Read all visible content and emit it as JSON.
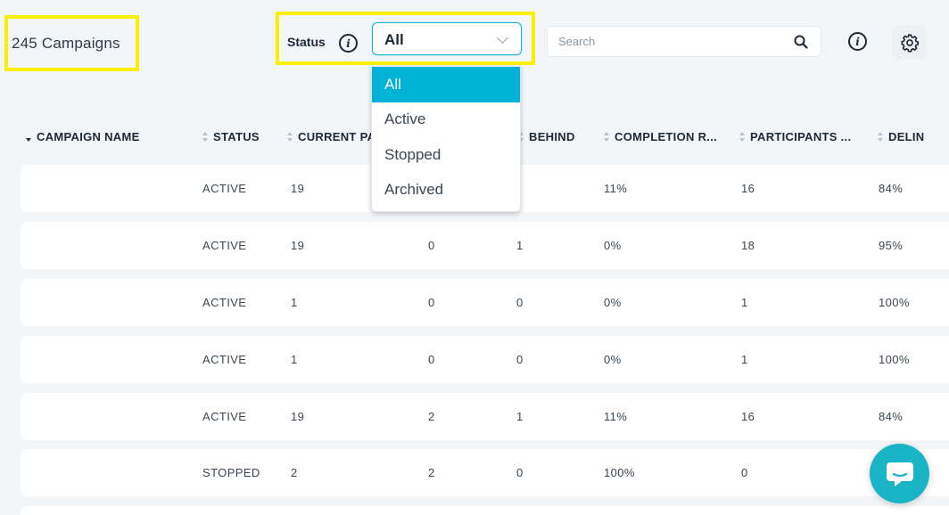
{
  "header": {
    "campaign_count": "245 Campaigns",
    "status_label": "Status",
    "status_selected": "All",
    "search_placeholder": "Search"
  },
  "status_options": [
    "All",
    "Active",
    "Stopped",
    "Archived"
  ],
  "columns": [
    "CAMPAIGN NAME",
    "STATUS",
    "CURRENT PA",
    "BEHIND",
    "COMPLETION R...",
    "PARTICIPANTS ...",
    "DELIN"
  ],
  "rows": [
    {
      "status": "ACTIVE",
      "current": "19",
      "col4": "",
      "behind": "",
      "completion": "11%",
      "participants": "16",
      "delin": "84%"
    },
    {
      "status": "ACTIVE",
      "current": "19",
      "col4": "0",
      "behind": "1",
      "completion": "0%",
      "participants": "18",
      "delin": "95%"
    },
    {
      "status": "ACTIVE",
      "current": "1",
      "col4": "0",
      "behind": "0",
      "completion": "0%",
      "participants": "1",
      "delin": "100%"
    },
    {
      "status": "ACTIVE",
      "current": "1",
      "col4": "0",
      "behind": "0",
      "completion": "0%",
      "participants": "1",
      "delin": "100%"
    },
    {
      "status": "ACTIVE",
      "current": "19",
      "col4": "2",
      "behind": "1",
      "completion": "11%",
      "participants": "16",
      "delin": "84%"
    },
    {
      "status": "STOPPED",
      "current": "2",
      "col4": "2",
      "behind": "0",
      "completion": "100%",
      "participants": "0",
      "delin": ""
    }
  ],
  "colors": {
    "highlight": "#f8f000",
    "accent": "#00b3d6",
    "chat": "#1bb4c6",
    "background": "#f3f6f9"
  },
  "icons": [
    "info-icon",
    "chevron-down-icon",
    "search-icon",
    "gear-icon",
    "sort-icon",
    "chat-icon"
  ]
}
